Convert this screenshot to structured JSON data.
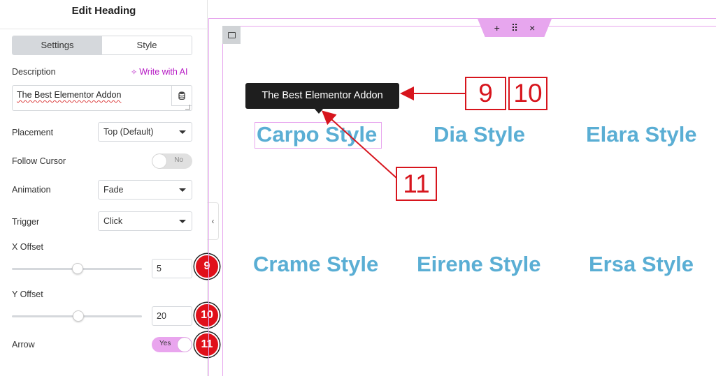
{
  "panel": {
    "title": "Edit Heading",
    "tabs": [
      {
        "label": "Settings",
        "active": true
      },
      {
        "label": "Style",
        "active": false
      }
    ],
    "description": {
      "label": "Description",
      "ai_link": "Write with AI",
      "value": "The Best Elementor Addon"
    },
    "placement": {
      "label": "Placement",
      "value": "Top (Default)"
    },
    "follow_cursor": {
      "label": "Follow Cursor",
      "value": "No"
    },
    "animation": {
      "label": "Animation",
      "value": "Fade"
    },
    "trigger": {
      "label": "Trigger",
      "value": "Click"
    },
    "x_offset": {
      "label": "X Offset",
      "value": "5",
      "slider_fraction": 0.5
    },
    "y_offset": {
      "label": "Y Offset",
      "value": "20",
      "slider_fraction": 0.5
    },
    "arrow": {
      "label": "Arrow",
      "value": "Yes"
    },
    "badges": [
      "9",
      "10",
      "11"
    ]
  },
  "canvas": {
    "toolbar": {
      "add": "+",
      "move": "⠿",
      "close": "×"
    },
    "tooltip_text": "The Best Elementor Addon",
    "styles": [
      "Carpo Style",
      "Dia Style",
      "Elara Style",
      "Crame Style",
      "Eirene Style",
      "Ersa Style"
    ],
    "callouts": [
      "9",
      "10",
      "11"
    ]
  },
  "colors": {
    "accent_pink": "#e7a6ee",
    "style_blue": "#5aaed4",
    "callout_red": "#d7151d",
    "ai_purple": "#b518c4"
  }
}
